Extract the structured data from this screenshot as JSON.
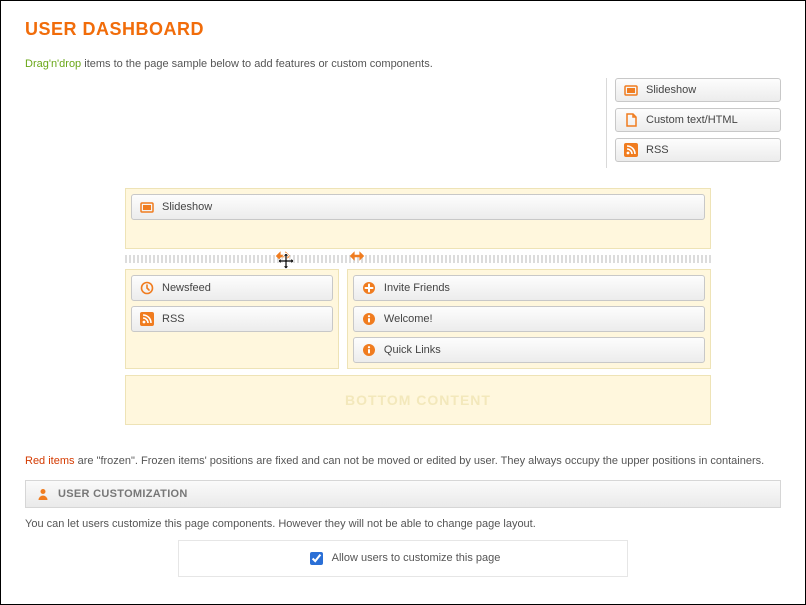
{
  "title": "USER DASHBOARD",
  "intro": {
    "highlight": "Drag'n'drop",
    "rest": " items to the page sample below to add features or custom components."
  },
  "palette": {
    "items": [
      {
        "label": "Slideshow",
        "icon": "slideshow"
      },
      {
        "label": "Custom text/HTML",
        "icon": "document"
      },
      {
        "label": "RSS",
        "icon": "rss"
      }
    ]
  },
  "layout": {
    "top": {
      "label": "Slideshow",
      "icon": "slideshow"
    },
    "left": [
      {
        "label": "Newsfeed",
        "icon": "clock"
      },
      {
        "label": "RSS",
        "icon": "rss"
      }
    ],
    "right": [
      {
        "label": "Invite Friends",
        "icon": "plus"
      },
      {
        "label": "Welcome!",
        "icon": "info"
      },
      {
        "label": "Quick Links",
        "icon": "info"
      }
    ],
    "bottom_placeholder": "BOTTOM CONTENT"
  },
  "frozen_note": {
    "highlight": "Red items",
    "rest": " are \"frozen\". Frozen items' positions are fixed and can not be moved or edited by user. They always occupy the upper positions in containers."
  },
  "section": {
    "title": "USER CUSTOMIZATION",
    "desc": "You can let users customize this page components. However they will not be able to change page layout.",
    "checkbox_label": "Allow users to customize this page",
    "checked": true
  }
}
